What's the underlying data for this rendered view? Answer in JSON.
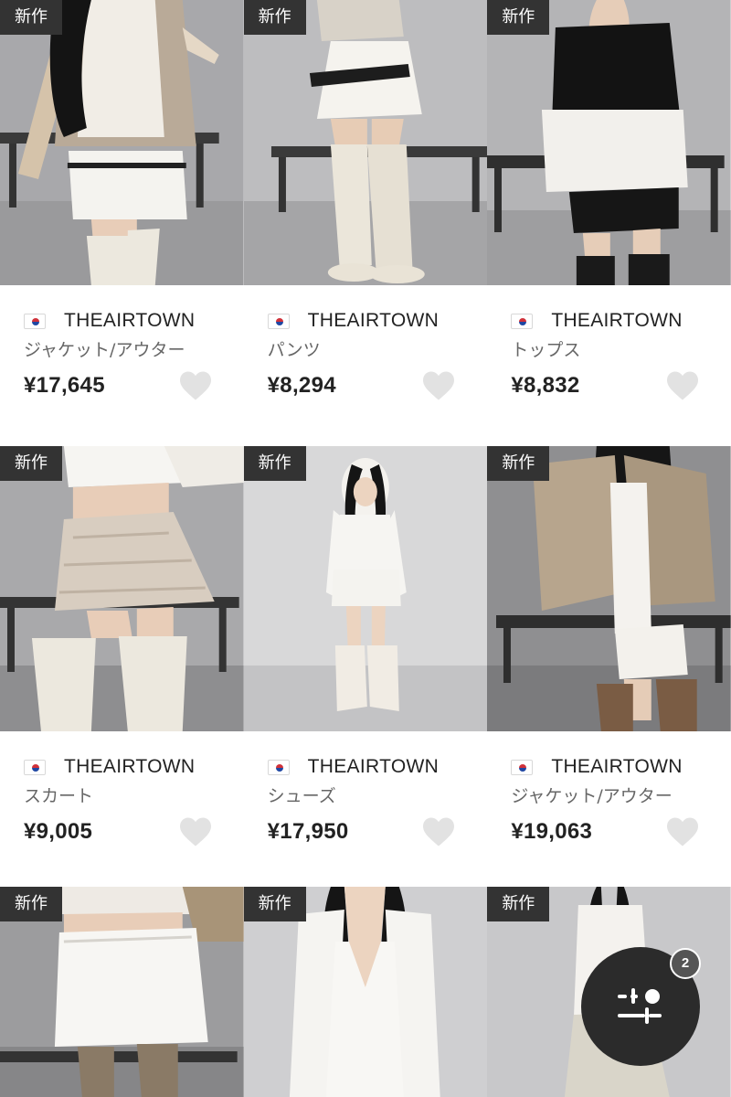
{
  "badge_label": "新作",
  "products": [
    {
      "brand": "THEAIRTOWN",
      "category": "ジャケット/アウター",
      "price": "¥17,645",
      "photo": "fur-jacket-white-shorts-leg-warmers"
    },
    {
      "brand": "THEAIRTOWN",
      "category": "パンツ",
      "price": "¥8,294",
      "photo": "white-shorts-belt-thigh-boots"
    },
    {
      "brand": "THEAIRTOWN",
      "category": "トップス",
      "price": "¥8,832",
      "photo": "black-hoodie-black-shorts"
    },
    {
      "brand": "THEAIRTOWN",
      "category": "スカート",
      "price": "¥9,005",
      "photo": "tiered-mini-skirt-leg-warmers"
    },
    {
      "brand": "THEAIRTOWN",
      "category": "シューズ",
      "price": "¥17,950",
      "photo": "white-dress-furry-boots"
    },
    {
      "brand": "THEAIRTOWN",
      "category": "ジャケット/アウター",
      "price": "¥19,063",
      "photo": "fur-coat-white-mini-skirt"
    },
    {
      "photo": "white-denim-mini-skirt"
    },
    {
      "photo": "white-off-shoulder-top"
    },
    {
      "photo": "white-blouse-long-skirt"
    }
  ],
  "filter_button": {
    "icon": "sliders-icon",
    "count": "2"
  },
  "colors": {
    "badge": "#333333",
    "fab": "#2b2b2b",
    "heart": "#e2e2e2",
    "text": "#222222",
    "subtext": "#666666"
  }
}
